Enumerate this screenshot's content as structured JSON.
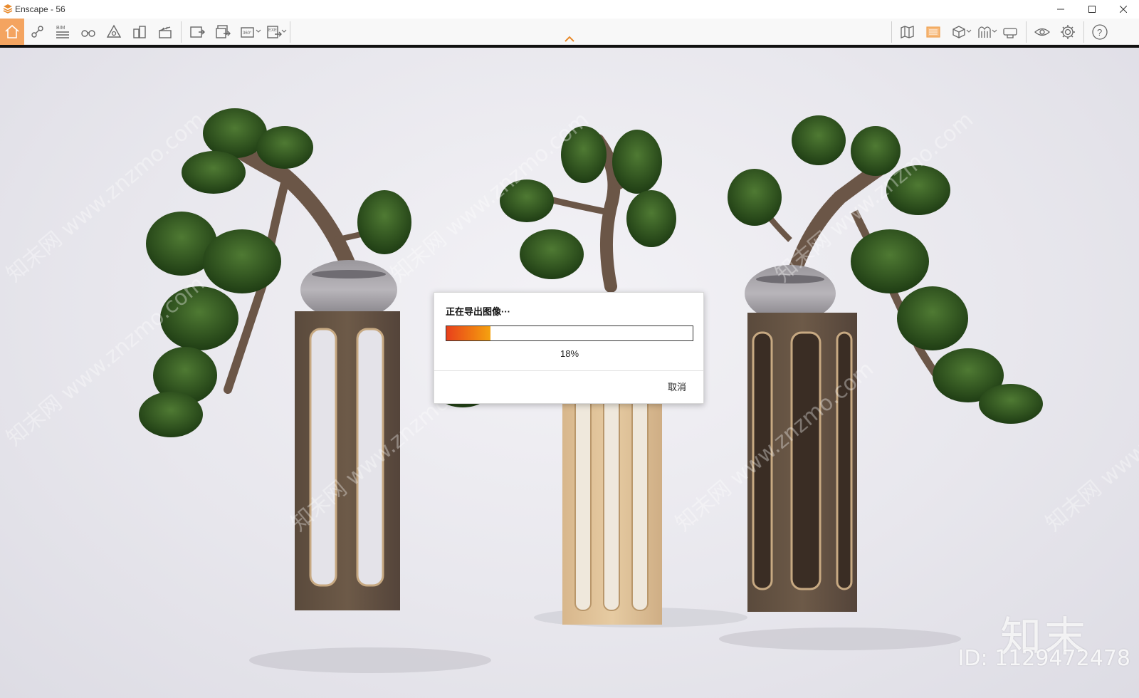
{
  "window": {
    "title": "Enscape - 56",
    "controls": [
      "minimize",
      "maximize",
      "close"
    ]
  },
  "toolbar": {
    "bim_label": "BIM",
    "left_tools": [
      {
        "name": "home-button",
        "icon": "home-icon"
      },
      {
        "name": "views-button",
        "icon": "camera-path-icon"
      },
      {
        "name": "bim-button",
        "icon": "bim-icon"
      },
      {
        "name": "binoculars-button",
        "icon": "binoculars-icon"
      },
      {
        "name": "asset-library-button",
        "icon": "asset-library-icon"
      },
      {
        "name": "site-context-button",
        "icon": "buildings-icon"
      },
      {
        "name": "video-editor-button",
        "icon": "clapperboard-icon"
      }
    ],
    "export_tools": [
      {
        "name": "screenshot-button",
        "icon": "image-export-icon"
      },
      {
        "name": "batch-render-button",
        "icon": "batch-export-icon"
      },
      {
        "name": "panorama-button",
        "icon": "panorama-icon",
        "label": "360°"
      },
      {
        "name": "export-exe-button",
        "icon": "exe-export-icon",
        "label": "EXE"
      }
    ],
    "right_tools": [
      {
        "name": "map-button",
        "icon": "map-icon"
      },
      {
        "name": "material-editor-button",
        "icon": "material-icon"
      },
      {
        "name": "view-mode-button",
        "icon": "cube-icon"
      },
      {
        "name": "atmosphere-button",
        "icon": "atmosphere-icon"
      },
      {
        "name": "vr-button",
        "icon": "vr-headset-icon"
      },
      {
        "name": "visual-settings-button",
        "icon": "eye-icon"
      },
      {
        "name": "settings-button",
        "icon": "gear-icon"
      },
      {
        "name": "help-button",
        "icon": "help-icon"
      }
    ]
  },
  "dialog": {
    "title": "正在导出图像···",
    "progress": 0.18,
    "progress_text": "18%",
    "cancel_label": "取消",
    "fill_colors": [
      "#e8401c",
      "#f5a20f"
    ]
  },
  "watermark": {
    "logo_text": "知末",
    "id_text": "ID: 1129472478",
    "diagonal_text": "知末网 www.znzmo.com"
  },
  "colors": {
    "accent": "#f4a460",
    "viewport_bg": "#e8e7ed"
  }
}
